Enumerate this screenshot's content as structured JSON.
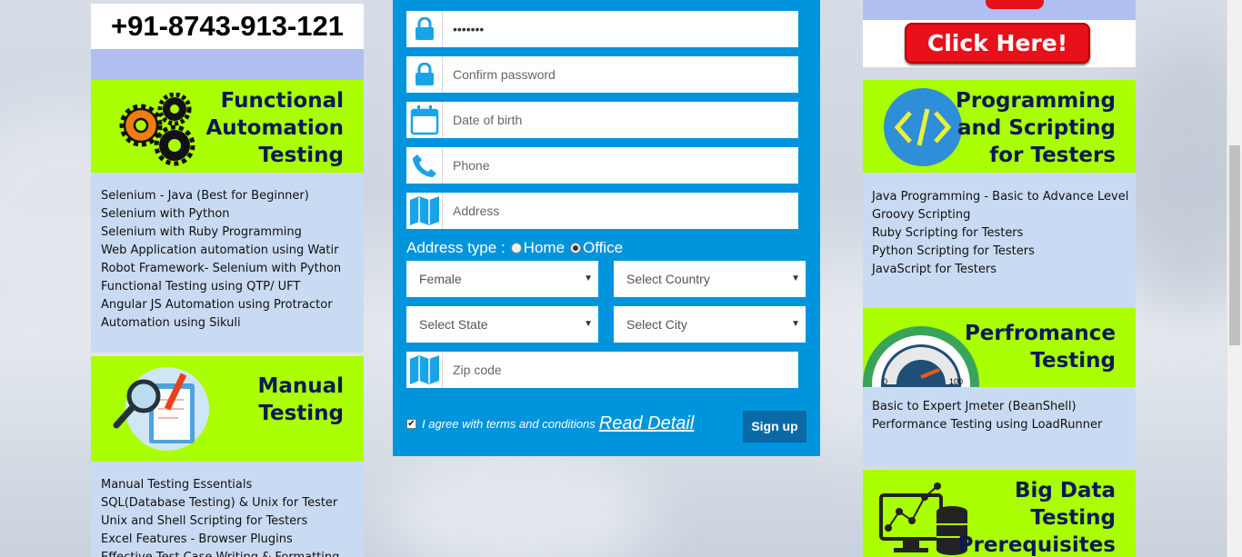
{
  "left": {
    "phone": "+91-8743-913-121",
    "functional": {
      "title_lines": [
        "Functional",
        "Automation",
        "Testing"
      ],
      "items": [
        "Selenium - Java (Best for Beginner)",
        "Selenium with Python",
        "Selenium with Ruby Programming",
        "Web Application automation using Watir",
        "Robot Framework- Selenium with Python",
        "Functional Testing using QTP/ UFT",
        "Angular JS Automation using Protractor",
        "Automation using Sikuli"
      ]
    },
    "manual": {
      "title_lines": [
        "Manual",
        "Testing"
      ],
      "items": [
        "Manual Testing Essentials",
        "SQL(Database Testing) & Unix for Tester",
        "Unix and Shell Scripting for Testers",
        "Excel Features - Browser Plugins",
        "Effective Test Case Writing & Formatting"
      ]
    }
  },
  "form": {
    "password_value": "•••••••",
    "confirm_password_placeholder": "Confirm password",
    "dob_placeholder": "Date of birth",
    "phone_placeholder": "Phone",
    "address_placeholder": "Address",
    "address_type_label": "Address type :",
    "address_type_options": [
      "Home",
      "Office"
    ],
    "address_type_selected": "Office",
    "gender_selected": "Female",
    "country_selected": "Select Country",
    "state_selected": "Select State",
    "city_selected": "Select City",
    "zip_placeholder": "Zip code",
    "agree_text": "I agree with terms and conditions",
    "read_detail": "Read Detail",
    "signup_label": "Sign up",
    "agree_checked": true
  },
  "right": {
    "click_here": "Click Here!",
    "programming": {
      "title_lines": [
        "Programming",
        "and Scripting",
        "for Testers"
      ],
      "items": [
        "Java Programming - Basic to Advance Level",
        "Groovy Scripting",
        "Ruby Scripting for Testers",
        "Python Scripting for Testers",
        "JavaScript for Testers"
      ]
    },
    "performance": {
      "title_lines": [
        "Perfromance",
        "Testing"
      ],
      "gauge_labels": [
        "0",
        "100"
      ],
      "items": [
        "Basic to Expert Jmeter (BeanShell)",
        "Performance Testing using LoadRunner"
      ]
    },
    "bigdata": {
      "title_lines": [
        "Big Data",
        "Testing",
        "Prerequisites"
      ]
    }
  },
  "colors": {
    "banner_green": "#aaff00",
    "form_blue": "#0094dc",
    "title_navy": "#0a1a55",
    "list_bg": "#c9dbf2",
    "click_red": "#e8101a"
  }
}
